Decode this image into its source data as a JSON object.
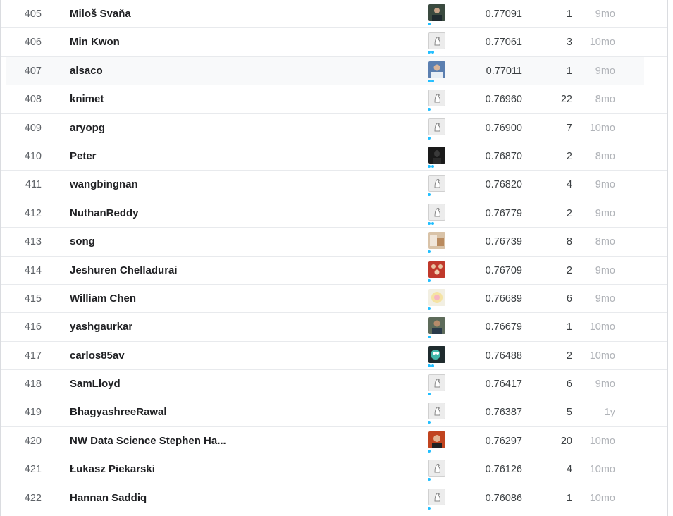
{
  "leaderboard": {
    "rows": [
      {
        "rank": "405",
        "team": "Miloš Svaňa",
        "score": "0.77091",
        "entries": "1",
        "last": "9mo",
        "avatar": "photo-dark",
        "tier": 1
      },
      {
        "rank": "406",
        "team": "Min Kwon",
        "score": "0.77061",
        "entries": "3",
        "last": "10mo",
        "avatar": "default",
        "tier": 2
      },
      {
        "rank": "407",
        "team": "alsaco",
        "score": "0.77011",
        "entries": "1",
        "last": "9mo",
        "avatar": "photo-blue",
        "tier": 2
      },
      {
        "rank": "408",
        "team": "knimet",
        "score": "0.76960",
        "entries": "22",
        "last": "8mo",
        "avatar": "default",
        "tier": 1
      },
      {
        "rank": "409",
        "team": "aryopg",
        "score": "0.76900",
        "entries": "7",
        "last": "10mo",
        "avatar": "default",
        "tier": 1
      },
      {
        "rank": "410",
        "team": "Peter",
        "score": "0.76870",
        "entries": "2",
        "last": "8mo",
        "avatar": "photo-black",
        "tier": 2
      },
      {
        "rank": "411",
        "team": "wangbingnan",
        "score": "0.76820",
        "entries": "4",
        "last": "9mo",
        "avatar": "default",
        "tier": 1
      },
      {
        "rank": "412",
        "team": "NuthanReddy",
        "score": "0.76779",
        "entries": "2",
        "last": "9mo",
        "avatar": "default",
        "tier": 2
      },
      {
        "rank": "413",
        "team": "song",
        "score": "0.76739",
        "entries": "8",
        "last": "8mo",
        "avatar": "photo-tan",
        "tier": 1
      },
      {
        "rank": "414",
        "team": "Jeshuren Chelladurai",
        "score": "0.76709",
        "entries": "2",
        "last": "9mo",
        "avatar": "photo-red",
        "tier": 1
      },
      {
        "rank": "415",
        "team": "William Chen",
        "score": "0.76689",
        "entries": "6",
        "last": "9mo",
        "avatar": "photo-flower",
        "tier": 1
      },
      {
        "rank": "416",
        "team": "yashgaurkar",
        "score": "0.76679",
        "entries": "1",
        "last": "10mo",
        "avatar": "photo-person",
        "tier": 1
      },
      {
        "rank": "417",
        "team": "carlos85av",
        "score": "0.76488",
        "entries": "2",
        "last": "10mo",
        "avatar": "photo-teal",
        "tier": 2
      },
      {
        "rank": "418",
        "team": "SamLloyd",
        "score": "0.76417",
        "entries": "6",
        "last": "9mo",
        "avatar": "default",
        "tier": 1
      },
      {
        "rank": "419",
        "team": "BhagyashreeRawal",
        "score": "0.76387",
        "entries": "5",
        "last": "1y",
        "avatar": "default",
        "tier": 1
      },
      {
        "rank": "420",
        "team": "NW Data Science Stephen Ha...",
        "score": "0.76297",
        "entries": "20",
        "last": "10mo",
        "avatar": "photo-orange",
        "tier": 1
      },
      {
        "rank": "421",
        "team": "Łukasz Piekarski",
        "score": "0.76126",
        "entries": "4",
        "last": "10mo",
        "avatar": "default",
        "tier": 1
      },
      {
        "rank": "422",
        "team": "Hannan Saddiq",
        "score": "0.76086",
        "entries": "1",
        "last": "10mo",
        "avatar": "default",
        "tier": 1
      }
    ]
  },
  "colors": {
    "tier_dot": "#20beff",
    "muted_text": "#b0b3b8",
    "row_border": "#e8eaed"
  }
}
